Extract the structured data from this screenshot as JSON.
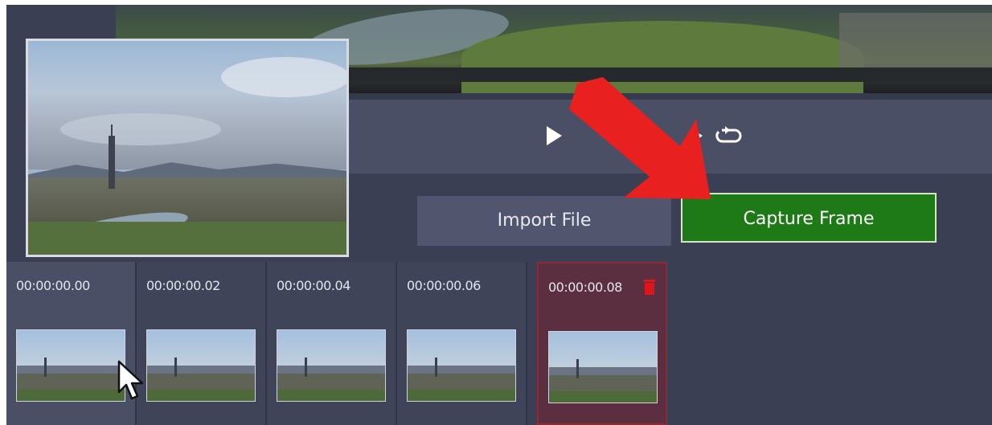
{
  "toolbar": {
    "import_label": "Import File",
    "capture_label": "Capture Frame"
  },
  "timeline": {
    "frames": [
      {
        "timestamp": "00:00:00.00"
      },
      {
        "timestamp": "00:00:00.02"
      },
      {
        "timestamp": "00:00:00.04"
      },
      {
        "timestamp": "00:00:00.06"
      },
      {
        "timestamp": "00:00:00.08"
      }
    ]
  },
  "icons": {
    "play": "play-icon",
    "next": "next-frame-icon",
    "loop": "loop-icon",
    "trash": "trash-icon",
    "cursor": "cursor-icon",
    "annotation": "red-arrow-annotation"
  },
  "colors": {
    "capture_bg": "#1e7a16",
    "selected_frame": "#5c2f40",
    "trash": "#e0141b",
    "arrow": "#e8201f"
  }
}
